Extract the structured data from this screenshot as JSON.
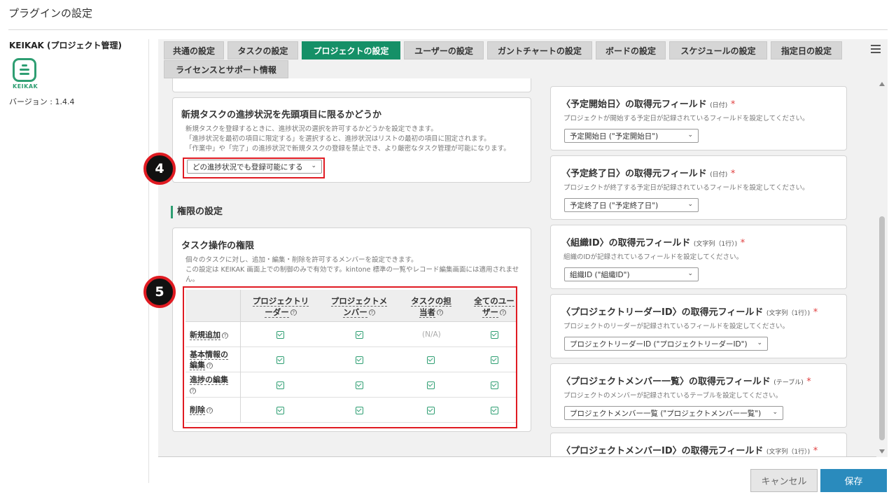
{
  "page_title": "プラグインの設定",
  "app": {
    "name": "KEIKAK (プロジェクト管理)",
    "logo_text": "KEIKAK",
    "version": "バージョン : 1.4.4"
  },
  "tabs": [
    {
      "label": "共通の設定"
    },
    {
      "label": "タスクの設定"
    },
    {
      "label": "プロジェクトの設定",
      "active": true
    },
    {
      "label": "ユーザーの設定"
    },
    {
      "label": "ガントチャートの設定"
    },
    {
      "label": "ボードの設定"
    },
    {
      "label": "スケジュールの設定"
    },
    {
      "label": "指定日の設定"
    },
    {
      "label": "ライセンスとサポート情報"
    }
  ],
  "new_task_status": {
    "title": "新規タスクの進捗状況を先頭項目に限るかどうか",
    "desc": [
      "新規タスクを登録するときに、進捗状況の選択を許可するかどうかを設定できます。",
      "「進捗状況を最初の項目に限定する」を選択すると、進捗状況はリストの最初の項目に固定されます。",
      "「作業中」や「完了」の進捗状況で新規タスクの登録を禁止でき、より厳密なタスク管理が可能になります。"
    ],
    "select_value": "どの進捗状況でも登録可能にする"
  },
  "permissions": {
    "section_heading": "権限の設定",
    "title": "タスク操作の権限",
    "desc": [
      "個々のタスクに対し、追加・編集・削除を許可するメンバーを設定できます。",
      "この設定は KEIKAK 画面上での制御のみで有効です。kintone 標準の一覧やレコード編集画面には適用されませ",
      "ん。"
    ],
    "columns": [
      [
        "プロジェクトリ",
        "ーダー"
      ],
      [
        "プロジェクトメ",
        "ンバー"
      ],
      [
        "タスクの担",
        "当者"
      ],
      [
        "全てのユー",
        "ザー"
      ]
    ],
    "rows": [
      {
        "label": [
          "新規追加"
        ],
        "values": [
          true,
          true,
          null,
          true
        ]
      },
      {
        "label": [
          "基本情報の",
          "編集"
        ],
        "values": [
          true,
          true,
          true,
          true
        ]
      },
      {
        "label": [
          "進捗の編集",
          ""
        ],
        "values": [
          true,
          true,
          true,
          true
        ]
      },
      {
        "label": [
          "削除"
        ],
        "values": [
          true,
          true,
          true,
          true
        ]
      }
    ],
    "na_text": "(N/A)"
  },
  "field_cards": [
    {
      "title": "〈予定開始日〉の取得元フィールド",
      "type": "(日付)",
      "required": "*",
      "desc": "プロジェクトが開始する予定日が記録されているフィールドを設定してください。",
      "select_value": "予定開始日 (\"予定開始日\")"
    },
    {
      "title": "〈予定終了日〉の取得元フィールド",
      "type": "(日付)",
      "required": "*",
      "desc": "プロジェクトが終了する予定日が記録されているフィールドを設定してください。",
      "select_value": "予定終了日 (\"予定終了日\")"
    },
    {
      "title": "〈組織ID〉の取得元フィールド",
      "type": "(文字列（1行）)",
      "required": "*",
      "desc": "組織のIDが記録されているフィールドを設定してください。",
      "select_value": "組織ID (\"組織ID\")"
    },
    {
      "title": "〈プロジェクトリーダーID〉の取得元フィールド",
      "type": "(文字列（1行）)",
      "required": "*",
      "desc": "プロジェクトのリーダーが記録されているフィールドを設定してください。",
      "select_value": "プロジェクトリーダーID (\"プロジェクトリーダーID\")"
    },
    {
      "title": "〈プロジェクトメンバー一覧〉の取得元フィールド",
      "type": "(テーブル)",
      "required": "*",
      "desc": "プロジェクトのメンバーが記録されているテーブルを設定してください。",
      "select_value": "プロジェクトメンバー一覧 (\"プロジェクトメンバー一覧\")"
    },
    {
      "title": "〈プロジェクトメンバーID〉の取得元フィールド",
      "type": "(文字列（1行）)",
      "required": "*"
    }
  ],
  "badges": [
    "4",
    "5"
  ],
  "buttons": {
    "cancel": "キャンセル",
    "save": "保存"
  },
  "colors": {
    "accent": "#159067",
    "callout": "#e01b22",
    "save": "#2a8bbd"
  }
}
